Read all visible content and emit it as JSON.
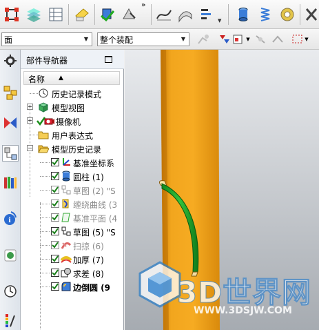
{
  "toolbar": {
    "more_label": "»"
  },
  "filter_bar": {
    "type_filter": "面",
    "scope_filter": "整个装配"
  },
  "navigator": {
    "title": "部件导航器",
    "column_header": "名称",
    "items": [
      {
        "label": "历史记录模式"
      },
      {
        "label": "模型视图"
      },
      {
        "label": "摄像机"
      },
      {
        "label": "用户表达式"
      },
      {
        "label": "模型历史记录"
      },
      {
        "label": "基准坐标系"
      },
      {
        "label": "圆柱 (1)"
      },
      {
        "label": "草图 (2) \"S"
      },
      {
        "label": "缠绕曲线 (3"
      },
      {
        "label": "基准平面 (4"
      },
      {
        "label": "草图 (5) \"S"
      },
      {
        "label": "扫掠 (6)"
      },
      {
        "label": "加厚 (7)"
      },
      {
        "label": "求差 (8)"
      },
      {
        "label": "边倒圆 (9"
      }
    ]
  },
  "watermark": {
    "brand": "3D世界网",
    "url": "WWW.3DSJW.COM"
  },
  "colors": {
    "cylinder": "#f4a016",
    "sweep": "#23a82a",
    "check": "#1a7f1a"
  }
}
